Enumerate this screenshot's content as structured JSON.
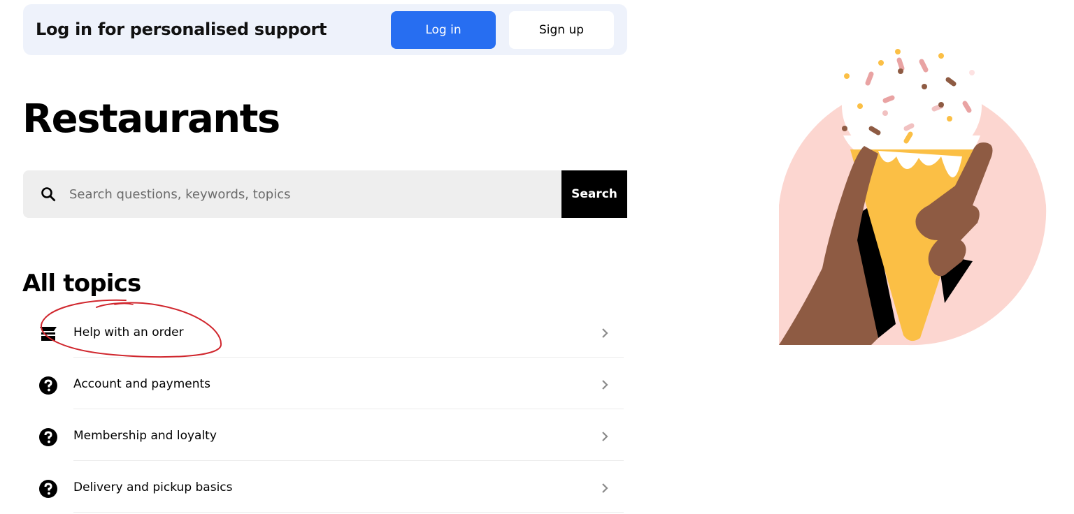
{
  "banner": {
    "text": "Log in for personalised support",
    "login_label": "Log in",
    "signup_label": "Sign up"
  },
  "page": {
    "title": "Restaurants"
  },
  "search": {
    "placeholder": "Search questions, keywords, topics",
    "value": "",
    "button_label": "Search"
  },
  "topics": {
    "heading": "All topics",
    "items": [
      {
        "label": "Help with an order",
        "icon": "order-bag-icon"
      },
      {
        "label": "Account and payments",
        "icon": "question-circle-icon"
      },
      {
        "label": "Membership and loyalty",
        "icon": "question-circle-icon"
      },
      {
        "label": "Delivery and pickup basics",
        "icon": "question-circle-icon"
      }
    ]
  },
  "colors": {
    "primary_button": "#276ef1",
    "banner_bg": "#eef2fb",
    "search_bg": "#eeeeee",
    "annotation": "#d0262d",
    "illustration_circle": "#fcd6d0",
    "cone": "#fbbf45",
    "hand": "#8e5b43"
  }
}
